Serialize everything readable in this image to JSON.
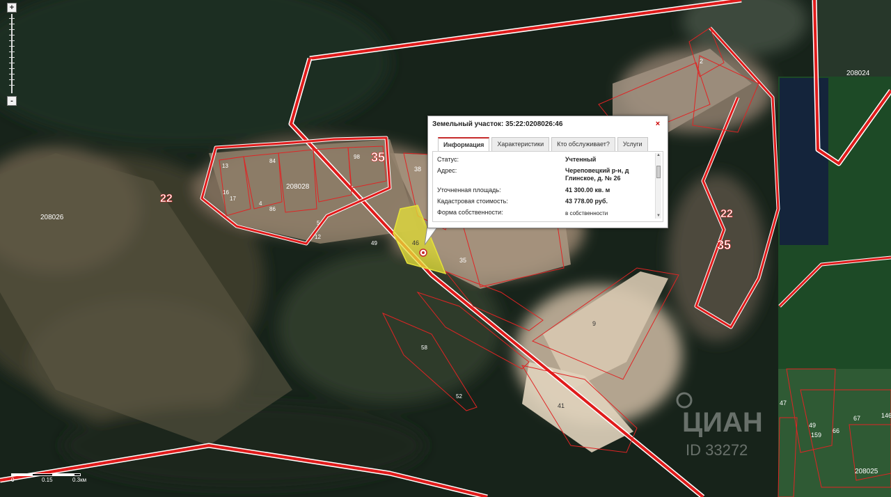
{
  "map": {
    "labels": {
      "q208026": "208026",
      "q208028": "208028",
      "q208024": "208024",
      "q208025": "208025",
      "n22_left": "22",
      "n35_top": "35",
      "n22_right": "22",
      "n35_right": "35",
      "n2": "2"
    },
    "parcels": {
      "p46": "46",
      "p35": "35",
      "p38": "38",
      "p9": "9",
      "p41": "41",
      "p13": "13",
      "p84": "84",
      "p86": "86",
      "p5": "5",
      "p49": "49",
      "p16": "16",
      "p17": "17",
      "p12": "12",
      "p4": "4",
      "p98": "98",
      "p47": "47",
      "p49b": "49",
      "p159": "159",
      "p66": "66",
      "p67": "67",
      "p146": "146",
      "p58": "58",
      "p52": "52"
    },
    "watermark": "ЦИАН",
    "watermark_id": "ID 33272",
    "colors": {
      "boundary": "#e01b1b",
      "selected": "#e6e23a",
      "popup_accent": "#c62a2a"
    }
  },
  "zoom": {
    "plus": "+",
    "minus": "-"
  },
  "scale": {
    "labels": [
      "0",
      "0.15",
      "0.3км"
    ]
  },
  "popup": {
    "title": "Земельный участок: 35:22:0208026:46",
    "close": "×",
    "tabs": [
      "Информация",
      "Характеристики",
      "Кто обслуживает?",
      "Услуги"
    ],
    "rows": [
      {
        "label": "Статус:",
        "value": "Учтенный"
      },
      {
        "label": "Адрес:",
        "value": "Череповецкий р-н, д",
        "value2": "Глинское, д. № 26"
      },
      {
        "label": "Уточненная площадь:",
        "value": "41 300.00 кв. м"
      },
      {
        "label": "Кадастровая стоимость:",
        "value": "43 778.00 руб."
      },
      {
        "label": "Форма собственности:",
        "value": "в собственности"
      }
    ]
  }
}
